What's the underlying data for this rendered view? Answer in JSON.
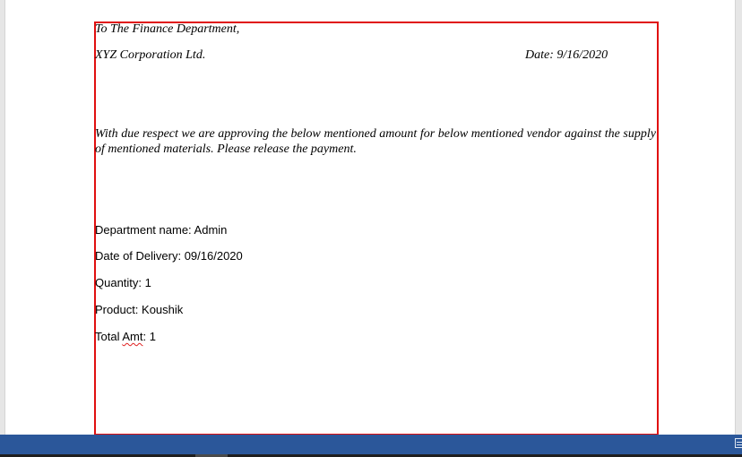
{
  "letter": {
    "salutation": "To The Finance Department,",
    "company": "XYZ Corporation Ltd.",
    "date": "Date: 9/16/2020",
    "paragraph": "With due respect we are approving the below mentioned amount for below mentioned vendor against the supply of mentioned materials. Please release the payment.",
    "fields": {
      "department": "Department name: Admin",
      "delivery": "Date of Delivery: 09/16/2020",
      "quantity": "Quantity: 1",
      "product": "Product: Koushik",
      "total_prefix": "Total ",
      "total_word": "Amt",
      "total_suffix": ": 1"
    }
  },
  "colors": {
    "frame_border": "#e01010",
    "status_bar": "#2b579a",
    "spellcheck": "#e02020"
  },
  "icons": {
    "status_bar_right": "view-layout-icon"
  }
}
